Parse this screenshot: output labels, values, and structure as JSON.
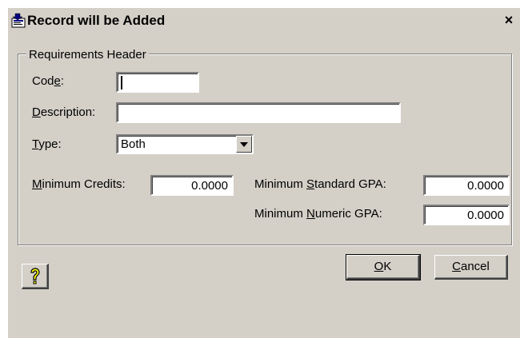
{
  "window": {
    "title": "Record will be Added",
    "close_glyph": "×",
    "icon": "record-add-icon"
  },
  "group": {
    "legend": "Requirements Header"
  },
  "fields": {
    "code": {
      "label_pre": "Cod",
      "label_ul": "e",
      "label_post": ":",
      "value": ""
    },
    "description": {
      "label_pre": "",
      "label_ul": "D",
      "label_post": "escription:",
      "value": ""
    },
    "type": {
      "label_pre": "",
      "label_ul": "T",
      "label_post": "ype:",
      "value": "Both"
    },
    "min_credits": {
      "label_pre": "",
      "label_ul": "M",
      "label_post": "inimum Credits:",
      "value": "0.0000"
    },
    "min_std_gpa": {
      "label_pre": "Minimum ",
      "label_ul": "S",
      "label_post": "tandard GPA:",
      "value": "0.0000"
    },
    "min_num_gpa": {
      "label_pre": "Minimum ",
      "label_ul": "N",
      "label_post": "umeric GPA:",
      "value": "0.0000"
    }
  },
  "buttons": {
    "help_icon": "question-mark-icon",
    "ok": {
      "ul": "O",
      "rest": "K"
    },
    "cancel": {
      "ul": "C",
      "rest": "ancel"
    }
  },
  "colors": {
    "face": "#d4d0c8",
    "field": "#ffffff",
    "help_glyph": "#ffff00"
  }
}
